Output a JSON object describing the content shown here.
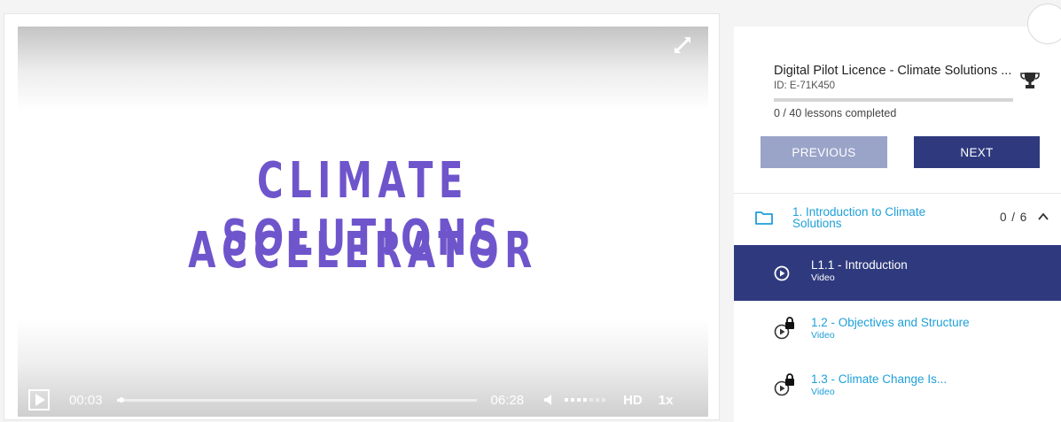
{
  "player": {
    "title_line1": "CLIMATE SOLUTIONS",
    "title_line2": "ACCELERATOR",
    "current_time": "00:03",
    "duration": "06:28",
    "progress_fraction": 0.008,
    "volume_level": 4,
    "volume_max": 7,
    "quality": "HD",
    "speed": "1x",
    "accent_color": "#6f55cc"
  },
  "course": {
    "title": "Digital Pilot Licence - Climate Solutions ...",
    "id": "ID: E-71K450",
    "progress_label": "0 / 40 lessons completed",
    "progress_fraction": 0,
    "previous_label": "PREVIOUS",
    "next_label": "NEXT",
    "primary_color": "#2f3a7e",
    "link_color": "#1e9fd8"
  },
  "section": {
    "title": "1. Introduction to Climate Solutions",
    "count": "0 / 6"
  },
  "lessons": [
    {
      "title": "L1.1 - Introduction",
      "type": "Video",
      "state": "active",
      "icon": "play-circle-icon"
    },
    {
      "title": "1.2 - Objectives and Structure",
      "type": "Video",
      "state": "locked",
      "icon": "locked-play-icon"
    },
    {
      "title": "1.3 - Climate Change Is...",
      "type": "Video",
      "state": "locked",
      "icon": "locked-play-icon"
    }
  ]
}
